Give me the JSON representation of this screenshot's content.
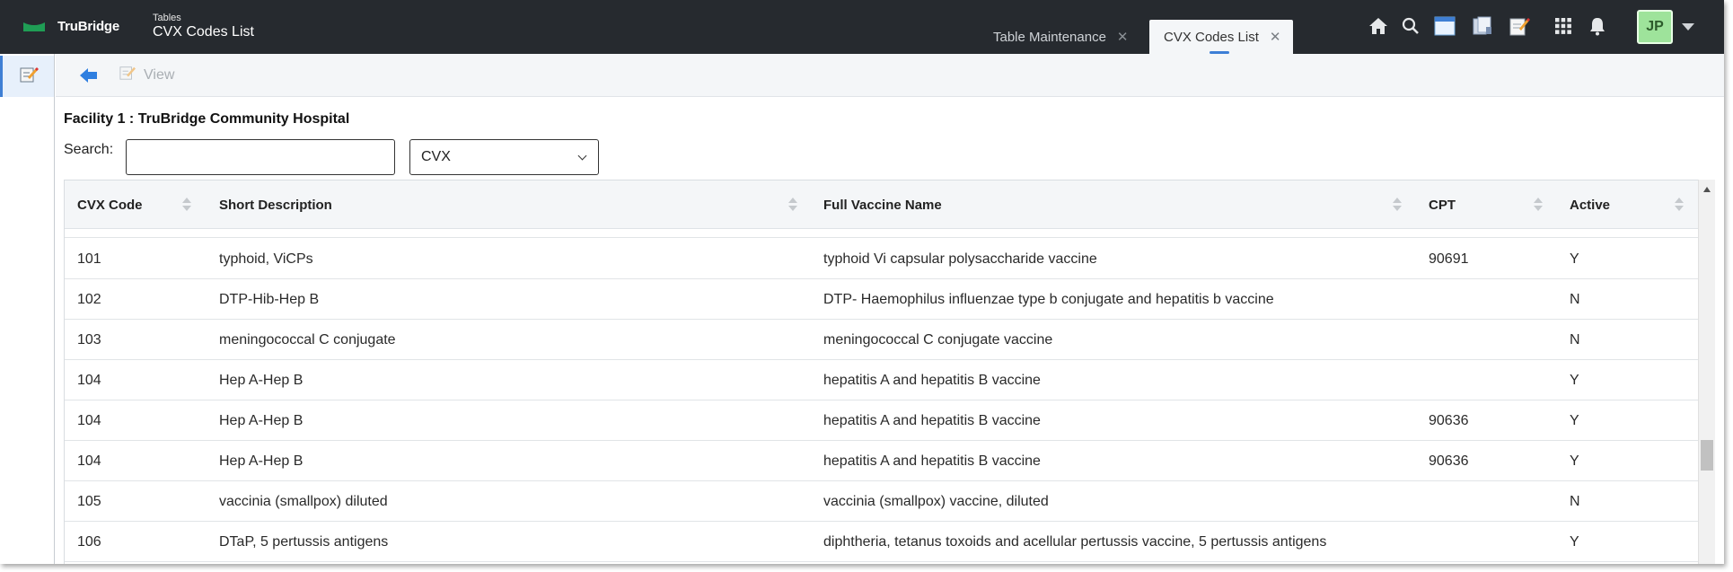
{
  "header": {
    "brand": "TruBridge",
    "section": "Tables",
    "title": "CVX Codes List",
    "tabs": [
      {
        "label": "Table Maintenance",
        "active": false
      },
      {
        "label": "CVX Codes List",
        "active": true
      }
    ],
    "user_initials": "JP",
    "icons": [
      "home-icon",
      "search-icon",
      "window-icon",
      "documents-icon",
      "notes-icon",
      "apps-grid-icon",
      "bell-icon"
    ]
  },
  "toolbar": {
    "view_label": "View"
  },
  "main": {
    "facility": "Facility 1 : TruBridge Community Hospital",
    "search_label": "Search:",
    "search_value": "",
    "filter_selected": "CVX"
  },
  "table": {
    "columns": [
      "CVX Code",
      "Short Description",
      "Full Vaccine Name",
      "CPT",
      "Active"
    ],
    "rows": [
      {
        "code": "101",
        "short": "typhoid, ViCPs",
        "full": "typhoid Vi capsular polysaccharide vaccine",
        "cpt": "90691",
        "active": "Y"
      },
      {
        "code": "102",
        "short": "DTP-Hib-Hep B",
        "full": "DTP- Haemophilus influenzae type b conjugate and hepatitis b vaccine",
        "cpt": "",
        "active": "N"
      },
      {
        "code": "103",
        "short": "meningococcal C conjugate",
        "full": "meningococcal C conjugate vaccine",
        "cpt": "",
        "active": "N"
      },
      {
        "code": "104",
        "short": "Hep A-Hep B",
        "full": "hepatitis A and hepatitis B vaccine",
        "cpt": "",
        "active": "Y"
      },
      {
        "code": "104",
        "short": "Hep A-Hep B",
        "full": "hepatitis A and hepatitis B vaccine",
        "cpt": "90636",
        "active": "Y"
      },
      {
        "code": "104",
        "short": "Hep A-Hep B",
        "full": "hepatitis A and hepatitis B vaccine",
        "cpt": "90636",
        "active": "Y"
      },
      {
        "code": "105",
        "short": "vaccinia (smallpox) diluted",
        "full": "vaccinia (smallpox) vaccine, diluted",
        "cpt": "",
        "active": "N"
      },
      {
        "code": "106",
        "short": "DTaP, 5 pertussis antigens",
        "full": "diphtheria, tetanus toxoids and acellular pertussis vaccine, 5 pertussis antigens",
        "cpt": "",
        "active": "Y"
      }
    ]
  },
  "colors": {
    "header_bg": "#262a2f",
    "accent": "#3f7fd4",
    "brand_green": "#1f9d55",
    "avatar_bg": "#9ee39b"
  }
}
